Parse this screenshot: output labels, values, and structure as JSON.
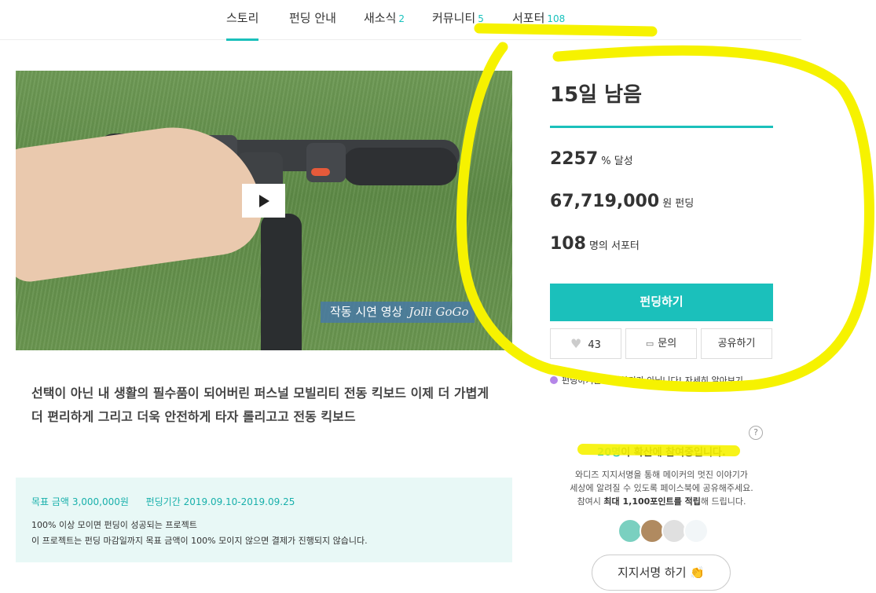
{
  "tabs": [
    {
      "label": "스토리",
      "count": ""
    },
    {
      "label": "펀딩 안내",
      "count": ""
    },
    {
      "label": "새소식",
      "count": "2"
    },
    {
      "label": "커뮤니티",
      "count": "5"
    },
    {
      "label": "서포터",
      "count": "108"
    }
  ],
  "video": {
    "caption": "작동 시연 영상",
    "logo": "Jolli GoGo"
  },
  "description": "선택이 아닌 내 생활의 필수품이 되어버린 퍼스널 모빌리티 전동 킥보드 이제 더 가볍게 더 편리하게 그리고 더욱 안전하게 타자 롤리고고 전동 킥보드",
  "goal": {
    "amount_label": "목표 금액",
    "amount": "3,000,000원",
    "period_label": "펀딩기간",
    "period": "2019.09.10-2019.09.25",
    "line1": "100% 이상 모이면 펀딩이 성공되는 프로젝트",
    "line2": "이 프로젝트는 펀딩 마감일까지 목표 금액이 100% 모이지 않으면 결제가 진행되지 않습니다."
  },
  "panel": {
    "days_left": "15일 남음",
    "progress_percent": 2257,
    "achieved": "2257",
    "achieved_unit": "% 달성",
    "funded": "67,719,000",
    "funded_unit": "원 펀딩",
    "supporters": "108",
    "supporters_unit": "명의 서포터",
    "fund_button": "펀딩하기",
    "like_count": "43",
    "inquiry_button": "문의",
    "share_button": "공유하기",
    "notice_text": "펀딩하기는 쇼핑하기가 아닙니다!",
    "notice_link": "자세히 알아보기"
  },
  "support": {
    "help": "?",
    "count": "20명",
    "title_suffix": "이 확산에 참여중입니다.",
    "desc1": "와디즈 지지서명을 통해 메이커의 멋진 이야기가",
    "desc2": "세상에 알려질 수 있도록 페이스북에 공유해주세요.",
    "desc3_pre": "참여시 ",
    "desc3_bold": "최대 1,100포인트를 적립",
    "desc3_post": "해 드립니다.",
    "sign_button": "지지서명 하기",
    "sign_icon": "👏"
  },
  "colors": {
    "accent": "#1bc0bb",
    "highlight": "#f6f200",
    "goal_bg": "#e8f8f6",
    "notice_dot": "#b486e8"
  },
  "icons": [
    "play-icon",
    "heart-icon",
    "comment-icon",
    "help-icon",
    "clap-icon"
  ]
}
